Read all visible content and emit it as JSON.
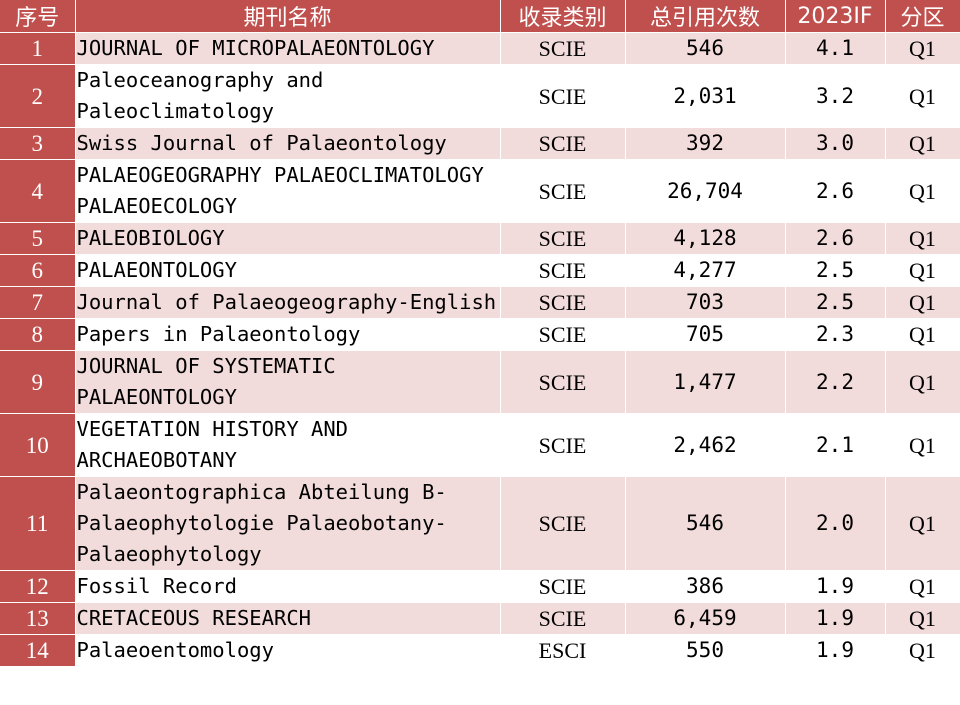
{
  "headers": {
    "idx": "序号",
    "name": "期刊名称",
    "category": "收录类别",
    "citations": "总引用次数",
    "if": "2023IF",
    "quartile": "分区"
  },
  "rows": [
    {
      "idx": "1",
      "name": "JOURNAL OF MICROPALAEONTOLOGY",
      "category": "SCIE",
      "citations": "546",
      "if": "4.1",
      "quartile": "Q1"
    },
    {
      "idx": "2",
      "name": "Paleoceanography and Paleoclimatology",
      "category": "SCIE",
      "citations": "2,031",
      "if": "3.2",
      "quartile": "Q1"
    },
    {
      "idx": "3",
      "name": "Swiss Journal of Palaeontology",
      "category": "SCIE",
      "citations": "392",
      "if": "3.0",
      "quartile": "Q1"
    },
    {
      "idx": "4",
      "name": "PALAEOGEOGRAPHY PALAEOCLIMATOLOGY PALAEOECOLOGY",
      "category": "SCIE",
      "citations": "26,704",
      "if": "2.6",
      "quartile": "Q1"
    },
    {
      "idx": "5",
      "name": "PALEOBIOLOGY",
      "category": "SCIE",
      "citations": "4,128",
      "if": "2.6",
      "quartile": "Q1"
    },
    {
      "idx": "6",
      "name": "PALAEONTOLOGY",
      "category": "SCIE",
      "citations": "4,277",
      "if": "2.5",
      "quartile": "Q1"
    },
    {
      "idx": "7",
      "name": "Journal of Palaeogeography-English",
      "category": "SCIE",
      "citations": "703",
      "if": "2.5",
      "quartile": "Q1"
    },
    {
      "idx": "8",
      "name": "Papers in Palaeontology",
      "category": "SCIE",
      "citations": "705",
      "if": "2.3",
      "quartile": "Q1"
    },
    {
      "idx": "9",
      "name": "JOURNAL OF SYSTEMATIC PALAEONTOLOGY",
      "category": "SCIE",
      "citations": "1,477",
      "if": "2.2",
      "quartile": "Q1"
    },
    {
      "idx": "10",
      "name": "VEGETATION HISTORY AND ARCHAEOBOTANY",
      "category": "SCIE",
      "citations": "2,462",
      "if": "2.1",
      "quartile": "Q1"
    },
    {
      "idx": "11",
      "name": "Palaeontographica Abteilung B-Palaeophytologie Palaeobotany-Palaeophytology",
      "category": "SCIE",
      "citations": "546",
      "if": "2.0",
      "quartile": "Q1"
    },
    {
      "idx": "12",
      "name": "Fossil Record",
      "category": "SCIE",
      "citations": "386",
      "if": "1.9",
      "quartile": "Q1"
    },
    {
      "idx": "13",
      "name": "CRETACEOUS RESEARCH",
      "category": "SCIE",
      "citations": "6,459",
      "if": "1.9",
      "quartile": "Q1"
    },
    {
      "idx": "14",
      "name": "Palaeoentomology",
      "category": "ESCI",
      "citations": "550",
      "if": "1.9",
      "quartile": "Q1"
    }
  ],
  "colors": {
    "header_bg": "#c0504d",
    "band_odd": "#f2dcdb",
    "band_even": "#ffffff",
    "header_text": "#ffffff"
  }
}
